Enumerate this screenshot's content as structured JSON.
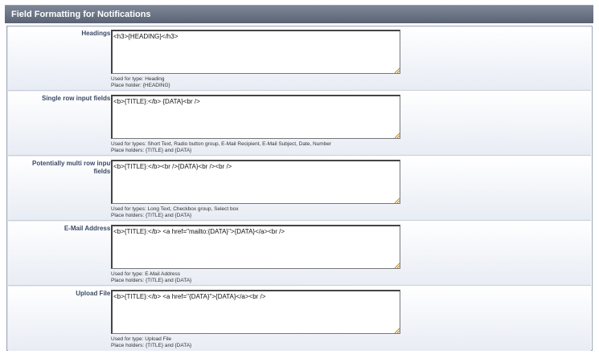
{
  "panel": {
    "title": "Field Formatting for Notifications"
  },
  "rows": [
    {
      "label": "Headings:",
      "value": "<h3>{HEADING}</h3>",
      "used_for": "Used for type: Heading",
      "placeholder": "Place holder: {HEADING}"
    },
    {
      "label": "Single row input fields:",
      "value": "<b>{TITLE}:</b> {DATA}<br />",
      "used_for": "Used for types: Short Text, Radio button group, E-Mail Recipient, E-Mail Subject, Date, Number",
      "placeholder": "Place holders: {TITLE} and {DATA}"
    },
    {
      "label": "Potentially multi row input fields:",
      "value": "<b>{TITLE}:</b><br />{DATA}<br /><br />",
      "used_for": "Used for types: Long Text, Checkbox group, Select box",
      "placeholder": "Place holders: {TITLE} and {DATA}"
    },
    {
      "label": "E-Mail Address:",
      "value": "<b>{TITLE}:</b> <a href=\"mailto:{DATA}\">{DATA}</a><br />",
      "used_for": "Used for type: E-Mail Address",
      "placeholder": "Place holders: {TITLE} and {DATA}"
    },
    {
      "label": "Upload File:",
      "value": "<b>{TITLE}:</b> <a href=\"{DATA}\">{DATA}</a><br />",
      "used_for": "Used for type: Upload File",
      "placeholder": "Place holders: {TITLE} and {DATA}"
    }
  ],
  "icons": {
    "resize": "resize-grip-icon"
  },
  "colors": {
    "header": "#5a6374",
    "label": "#3b4a66"
  }
}
